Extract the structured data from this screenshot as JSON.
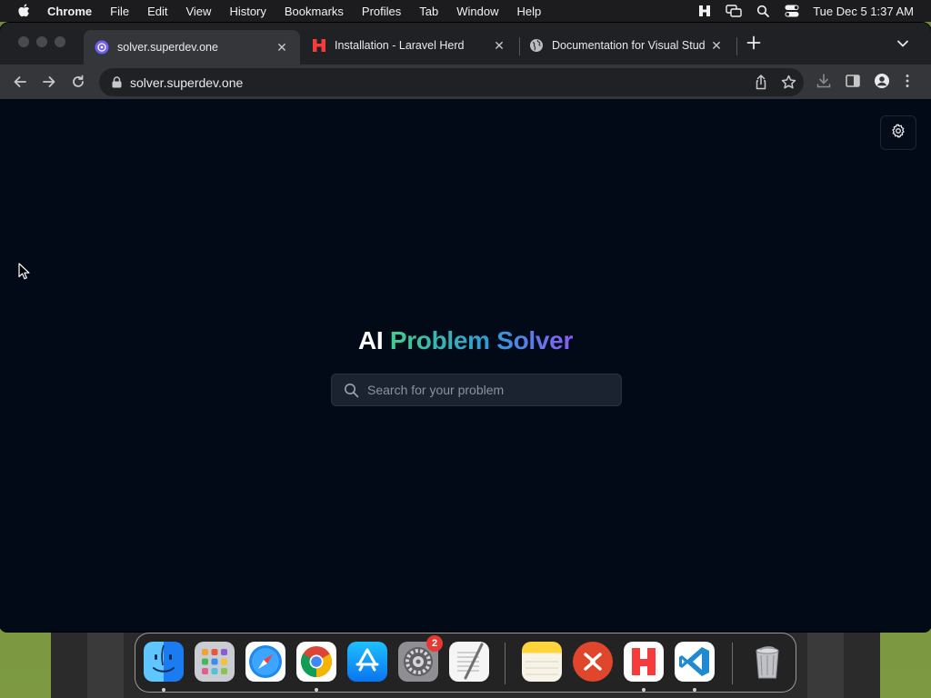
{
  "menubar": {
    "app_name": "Chrome",
    "items": [
      "File",
      "Edit",
      "View",
      "History",
      "Bookmarks",
      "Profiles",
      "Tab",
      "Window",
      "Help"
    ],
    "clock": "Tue Dec 5  1:37 AM"
  },
  "tabs": [
    {
      "title": "solver.superdev.one",
      "icon": "site-favicon",
      "active": true
    },
    {
      "title": "Installation - Laravel Herd",
      "icon": "herd-favicon",
      "active": false
    },
    {
      "title": "Documentation for Visual Stud",
      "icon": "globe-icon",
      "active": false
    }
  ],
  "address_bar": {
    "url": "solver.superdev.one"
  },
  "page": {
    "headline_plain": "AI",
    "headline_gradient": "Problem Solver",
    "search_placeholder": "Search for your problem",
    "colors": {
      "background": "#030a17",
      "gradient_start": "#3fd08b",
      "gradient_mid": "#2e9bd9",
      "gradient_end": "#8b5cf6"
    }
  },
  "dock": {
    "apps": [
      "Finder",
      "Launchpad",
      "Safari",
      "Chrome",
      "App Store",
      "System Settings",
      "TextEdit",
      "Notes",
      "Remote Desktop",
      "Laravel Herd",
      "Visual Studio Code",
      "Trash"
    ],
    "system_settings_badge": "2"
  }
}
